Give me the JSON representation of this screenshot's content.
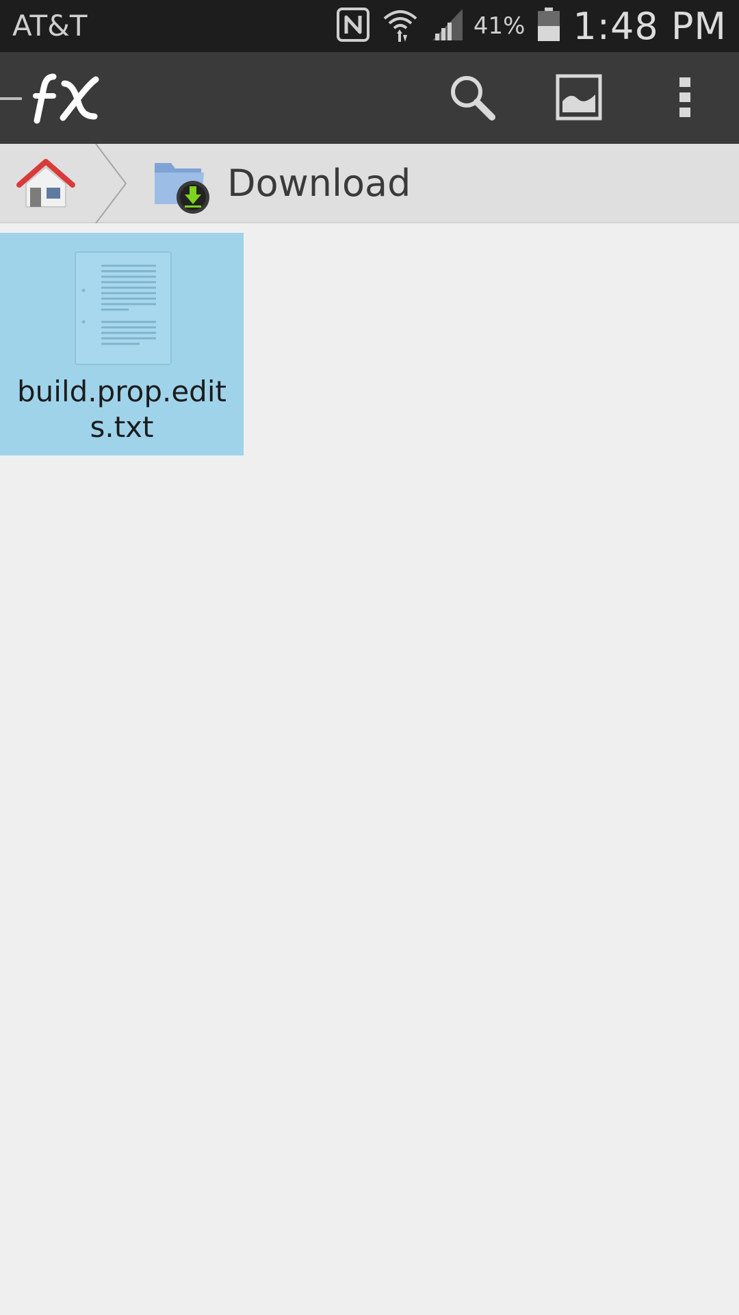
{
  "status_bar": {
    "carrier": "AT&T",
    "battery_percent": "41%",
    "time": "1:48 PM",
    "icons": [
      "nfc-icon",
      "wifi-icon",
      "signal-icon",
      "battery-icon"
    ]
  },
  "action_bar": {
    "app_logo": "fx",
    "actions": [
      "search-icon",
      "thumbnail-view-icon",
      "overflow-menu-icon"
    ]
  },
  "breadcrumb": {
    "home_icon": "home-icon",
    "current_folder": "Download",
    "folder_icon": "download-folder-icon"
  },
  "files": [
    {
      "name": "build.prop.edits.txt",
      "icon": "text-file-icon",
      "selected": true
    }
  ],
  "colors": {
    "status_bar": "#1d1d1d",
    "action_bar": "#3a3a3a",
    "breadcrumb_bar": "#dfdfe0",
    "background": "#efeff0",
    "selection": "#9fd3ea"
  }
}
